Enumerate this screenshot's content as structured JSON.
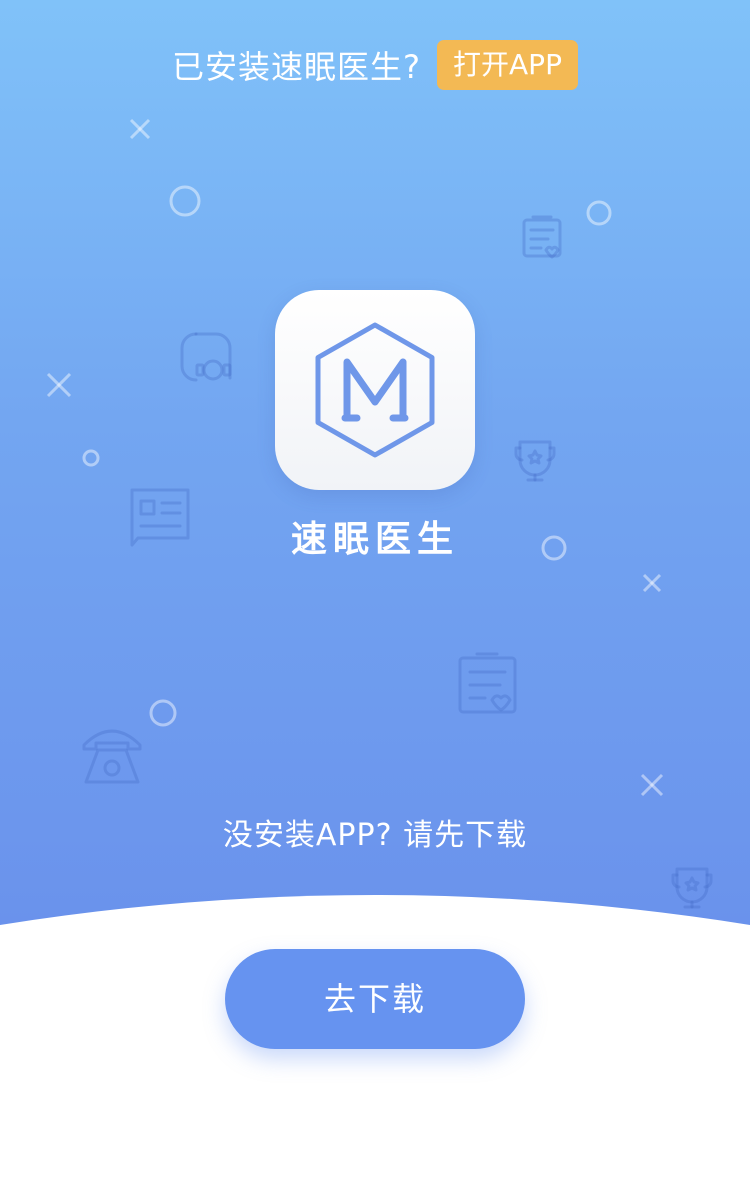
{
  "header": {
    "installed_prompt": "已安装速眠医生?",
    "open_app_label": "打开APP"
  },
  "app": {
    "name": "速眠医生",
    "icon": "hexagon-m-logo"
  },
  "download": {
    "prompt": "没安装APP?  请先下载",
    "button_label": "去下载"
  },
  "colors": {
    "gradient_top": "#80c2f9",
    "gradient_bottom": "#6a92ec",
    "open_button": "#f3b954",
    "download_button": "#6693f0",
    "logo_stroke": "#6f97e9"
  },
  "decorations": [
    "cross-icon",
    "circle-icon",
    "medical-record-icon",
    "headset-icon",
    "trophy-icon",
    "news-chat-icon",
    "telephone-icon"
  ]
}
